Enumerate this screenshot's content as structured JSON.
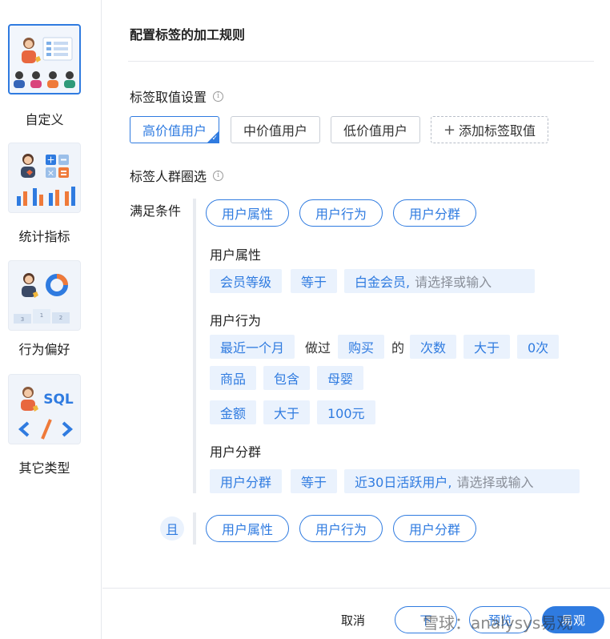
{
  "sidebar": {
    "items": [
      {
        "label": "自定义",
        "icon": "custom-people-icon",
        "active": true
      },
      {
        "label": "统计指标",
        "icon": "statistics-calculator-icon",
        "active": false
      },
      {
        "label": "行为偏好",
        "icon": "behavior-podium-icon",
        "active": false
      },
      {
        "label": "其它类型",
        "icon": "sql-code-icon",
        "active": false
      }
    ],
    "sql_text": "SQL",
    "podium_numbers": [
      "3",
      "1",
      "2"
    ]
  },
  "page": {
    "title": "配置标签的加工规则"
  },
  "tag_values": {
    "section_title": "标签取值设置",
    "info": "i",
    "options": [
      "高价值用户",
      "中价值用户",
      "低价值用户"
    ],
    "selected_index": 0,
    "add_label": "添加标签取值",
    "add_plus": "+"
  },
  "crowd": {
    "section_title": "标签人群圈选",
    "info": "i",
    "condition_label": "满足条件",
    "filter_types": [
      "用户属性",
      "用户行为",
      "用户分群"
    ],
    "attribute": {
      "title": "用户属性",
      "field": "会员等级",
      "operator": "等于",
      "value": "白金会员,",
      "placeholder": "请选择或输入"
    },
    "behavior": {
      "title": "用户行为",
      "period": "最近一个月",
      "did": "做过",
      "action": "购买",
      "of": "的",
      "metric": "次数",
      "compare": "大于",
      "amount": "0次",
      "row2": {
        "field": "商品",
        "operator": "包含",
        "value": "母婴"
      },
      "row3": {
        "field": "金额",
        "operator": "大于",
        "value": "100元"
      }
    },
    "segment": {
      "title": "用户分群",
      "field": "用户分群",
      "operator": "等于",
      "value": "近30日活跃用户,",
      "placeholder": "请选择或输入"
    },
    "and_label": "且",
    "and_filter_types": [
      "用户属性",
      "用户行为",
      "用户分群"
    ]
  },
  "footer": {
    "cancel": "取消",
    "prev": "下",
    "preview": "预览",
    "confirm": "易观"
  },
  "watermark": "雪球：analysys易观",
  "colors": {
    "accent": "#2f7be0",
    "chip_bg": "#eaf2fd"
  }
}
